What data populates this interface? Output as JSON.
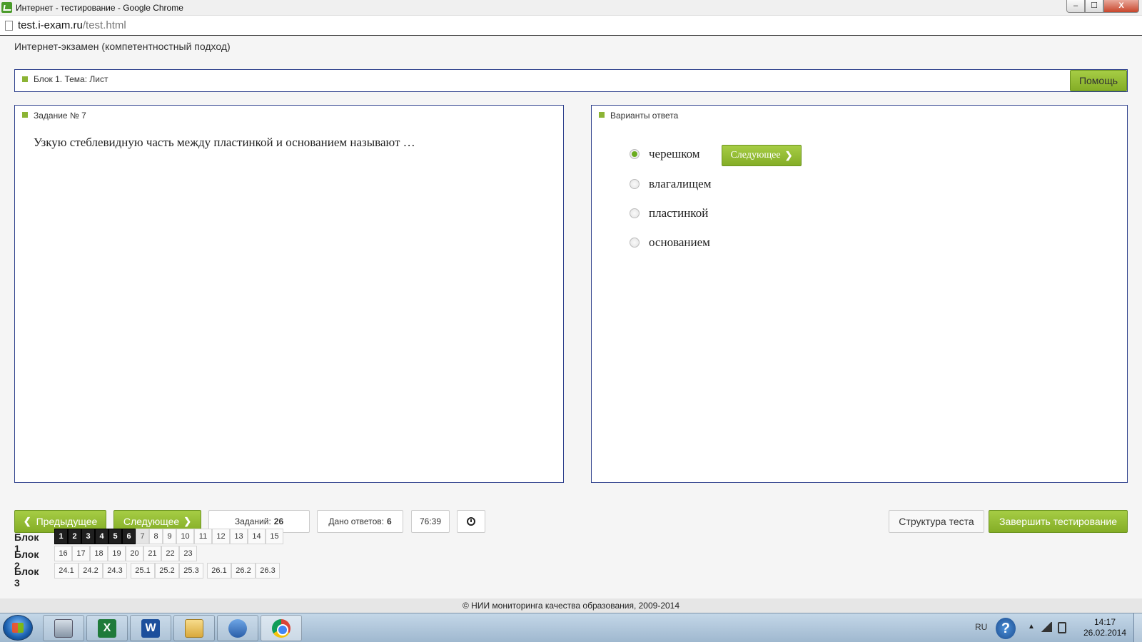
{
  "window": {
    "title": "Интернет - тестирование - Google Chrome",
    "controls": {
      "minimize": "–",
      "maximize": "☐",
      "close": "X"
    }
  },
  "address": {
    "host": "test.i-exam.ru",
    "path": "/test.html"
  },
  "page": {
    "title": "Интернет-экзамен (компетентностный подход)"
  },
  "block_panel": {
    "label": "Блок 1. Тема: Лист",
    "help_label": "Помощь"
  },
  "question": {
    "label": "Задание № 7",
    "text": "Узкую стеблевидную часть между пластинкой и основанием называют …"
  },
  "answers": {
    "label": "Варианты ответа",
    "next_label": "Следующее",
    "options": [
      {
        "text": "черешком",
        "selected": true
      },
      {
        "text": "влагалищем",
        "selected": false
      },
      {
        "text": "пластинкой",
        "selected": false
      },
      {
        "text": "основанием",
        "selected": false
      }
    ]
  },
  "toolbar": {
    "prev_label": "Предыдущее",
    "next_label": "Следующее",
    "tasks_label": "Заданий:",
    "tasks_value": "26",
    "answered_label": "Дано ответов:",
    "answered_value": "6",
    "timer": "76:39",
    "clock_icon": "clock-icon",
    "structure_label": "Структура теста",
    "finish_label": "Завершить тестирование"
  },
  "blocks": [
    {
      "label": "Блок 1",
      "cells": [
        {
          "n": "1",
          "state": "done"
        },
        {
          "n": "2",
          "state": "done"
        },
        {
          "n": "3",
          "state": "done"
        },
        {
          "n": "4",
          "state": "done"
        },
        {
          "n": "5",
          "state": "done"
        },
        {
          "n": "6",
          "state": "done"
        },
        {
          "n": "7",
          "state": "current"
        },
        {
          "n": "8",
          "state": "open"
        },
        {
          "n": "9",
          "state": "open"
        },
        {
          "n": "10",
          "state": "open"
        },
        {
          "n": "11",
          "state": "open"
        },
        {
          "n": "12",
          "state": "open"
        },
        {
          "n": "13",
          "state": "open"
        },
        {
          "n": "14",
          "state": "open"
        },
        {
          "n": "15",
          "state": "open"
        }
      ]
    },
    {
      "label": "Блок 2",
      "cells": [
        {
          "n": "16",
          "state": "open"
        },
        {
          "n": "17",
          "state": "open"
        },
        {
          "n": "18",
          "state": "open"
        },
        {
          "n": "19",
          "state": "open"
        },
        {
          "n": "20",
          "state": "open"
        },
        {
          "n": "21",
          "state": "open"
        },
        {
          "n": "22",
          "state": "open"
        },
        {
          "n": "23",
          "state": "open"
        }
      ]
    },
    {
      "label": "Блок 3",
      "cells": [
        {
          "n": "24.1",
          "state": "open"
        },
        {
          "n": "24.2",
          "state": "open"
        },
        {
          "n": "24.3",
          "state": "open"
        },
        {
          "n": "25.1",
          "state": "open"
        },
        {
          "n": "25.2",
          "state": "open"
        },
        {
          "n": "25.3",
          "state": "open"
        },
        {
          "n": "26.1",
          "state": "open"
        },
        {
          "n": "26.2",
          "state": "open"
        },
        {
          "n": "26.3",
          "state": "open"
        }
      ]
    }
  ],
  "footer": {
    "text": "© НИИ мониторинга качества образования, 2009-2014"
  },
  "taskbar": {
    "apps": [
      "calculator-icon",
      "excel-icon",
      "word-icon",
      "explorer-icon",
      "sound-icon",
      "chrome-icon"
    ],
    "excel_glyph": "X",
    "word_glyph": "W",
    "lang": "RU",
    "help_glyph": "?",
    "time": "14:17",
    "date": "26.02.2014"
  },
  "colors": {
    "accent_green": "#8cb435",
    "panel_border": "#2d3f8c",
    "done_cell": "#1f1f1f"
  }
}
